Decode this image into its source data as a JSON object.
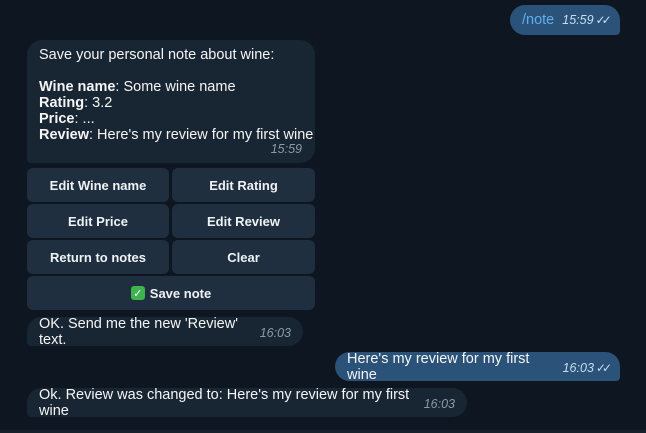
{
  "messages": {
    "note_cmd": {
      "text": "/note",
      "time": "15:59",
      "status": "read"
    },
    "main": {
      "intro": "Save your personal note about wine:",
      "fields": [
        {
          "label": "Wine name",
          "value": ": Some wine name"
        },
        {
          "label": "Rating",
          "value": ": 3.2"
        },
        {
          "label": "Price",
          "value": ": ..."
        },
        {
          "label": "Review",
          "value": ": Here's my review for my first wine"
        }
      ],
      "time": "15:59"
    },
    "ok_send": {
      "text": "OK. Send me the new 'Review' text.",
      "time": "16:03"
    },
    "review_reply": {
      "text": "Here's my review for my first wine",
      "time": "16:03",
      "status": "read"
    },
    "ok_changed": {
      "text": "Ok. Review was changed to: Here's my review for my first wine",
      "time": "16:03"
    }
  },
  "keyboard": {
    "edit_wine_name": "Edit Wine name",
    "edit_rating": "Edit Rating",
    "edit_price": "Edit Price",
    "edit_review": "Edit Review",
    "return_to_notes": "Return to notes",
    "clear": "Clear",
    "save_note": "Save note",
    "save_note_icon": "white-check-mark-icon"
  },
  "colors": {
    "background": "#0e1621",
    "incoming_bubble": "#182533",
    "outgoing_bubble": "#2b5278",
    "keyboard_button": "#1f2f3f",
    "command_link": "#62aef0",
    "check_emoji": "#3fb34f"
  }
}
